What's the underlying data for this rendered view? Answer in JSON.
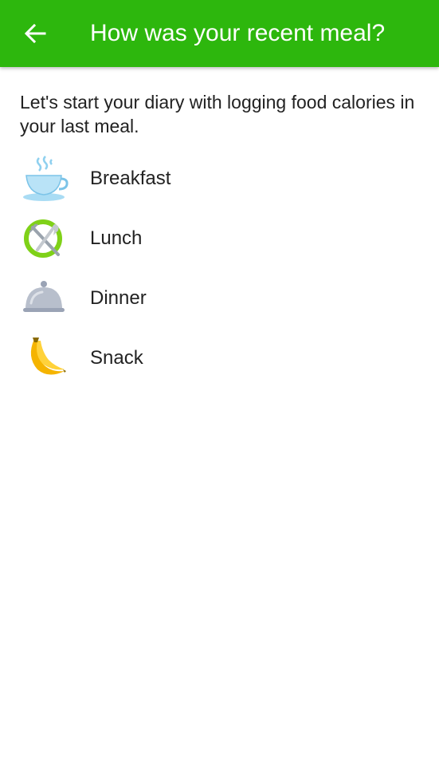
{
  "header": {
    "title": "How was your recent meal?",
    "back_icon": "arrow-left-icon",
    "color": "#2db70d"
  },
  "intro": {
    "text": "Let's start your diary with logging food calories in your last meal."
  },
  "meals": [
    {
      "label": "Breakfast",
      "icon": "coffee-cup-icon"
    },
    {
      "label": "Lunch",
      "icon": "fork-knife-icon"
    },
    {
      "label": "Dinner",
      "icon": "cloche-icon"
    },
    {
      "label": "Snack",
      "icon": "banana-icon"
    }
  ]
}
